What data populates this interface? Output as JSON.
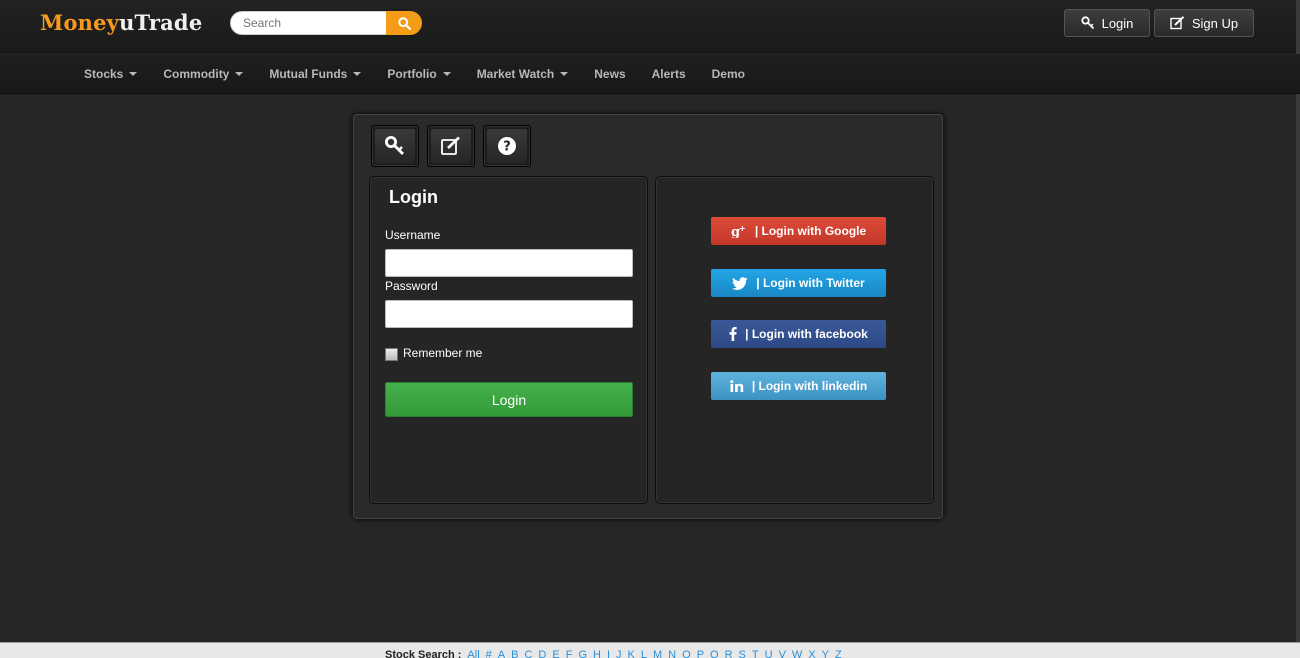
{
  "header": {
    "logo_part1": "Money",
    "logo_part2": "uTrade",
    "search_placeholder": "Search",
    "login_label": "Login",
    "signup_label": "Sign Up"
  },
  "nav": {
    "items": [
      {
        "label": "Stocks",
        "dropdown": true
      },
      {
        "label": "Commodity",
        "dropdown": true
      },
      {
        "label": "Mutual Funds",
        "dropdown": true
      },
      {
        "label": "Portfolio",
        "dropdown": true
      },
      {
        "label": "Market Watch",
        "dropdown": true
      },
      {
        "label": "News",
        "dropdown": false
      },
      {
        "label": "Alerts",
        "dropdown": false
      },
      {
        "label": "Demo",
        "dropdown": false
      }
    ]
  },
  "login_panel": {
    "tabs": [
      "key-icon",
      "edit-icon",
      "help-icon"
    ],
    "title": "Login",
    "username_label": "Username",
    "username_value": "",
    "password_label": "Password",
    "password_value": "",
    "remember_label": "Remember me",
    "remember_checked": false,
    "submit_label": "Login"
  },
  "social": {
    "google": "| Login with Google",
    "twitter": "| Login with Twitter",
    "facebook": "| Login with facebook",
    "linkedin": "| Login with linkedin"
  },
  "footer": {
    "label": "Stock Search :",
    "letters": [
      "All",
      "#",
      "A",
      "B",
      "C",
      "D",
      "E",
      "F",
      "G",
      "H",
      "I",
      "J",
      "K",
      "L",
      "M",
      "N",
      "O",
      "P",
      "Q",
      "R",
      "S",
      "T",
      "U",
      "V",
      "W",
      "X",
      "Y",
      "Z"
    ]
  },
  "colors": {
    "accent": "#f39a1f",
    "login_green": "#3aa641",
    "google": "#d4412f",
    "twitter": "#1e9bd9",
    "facebook": "#34508f",
    "linkedin": "#4ea3d0",
    "footer_link": "#2a8fd8"
  }
}
